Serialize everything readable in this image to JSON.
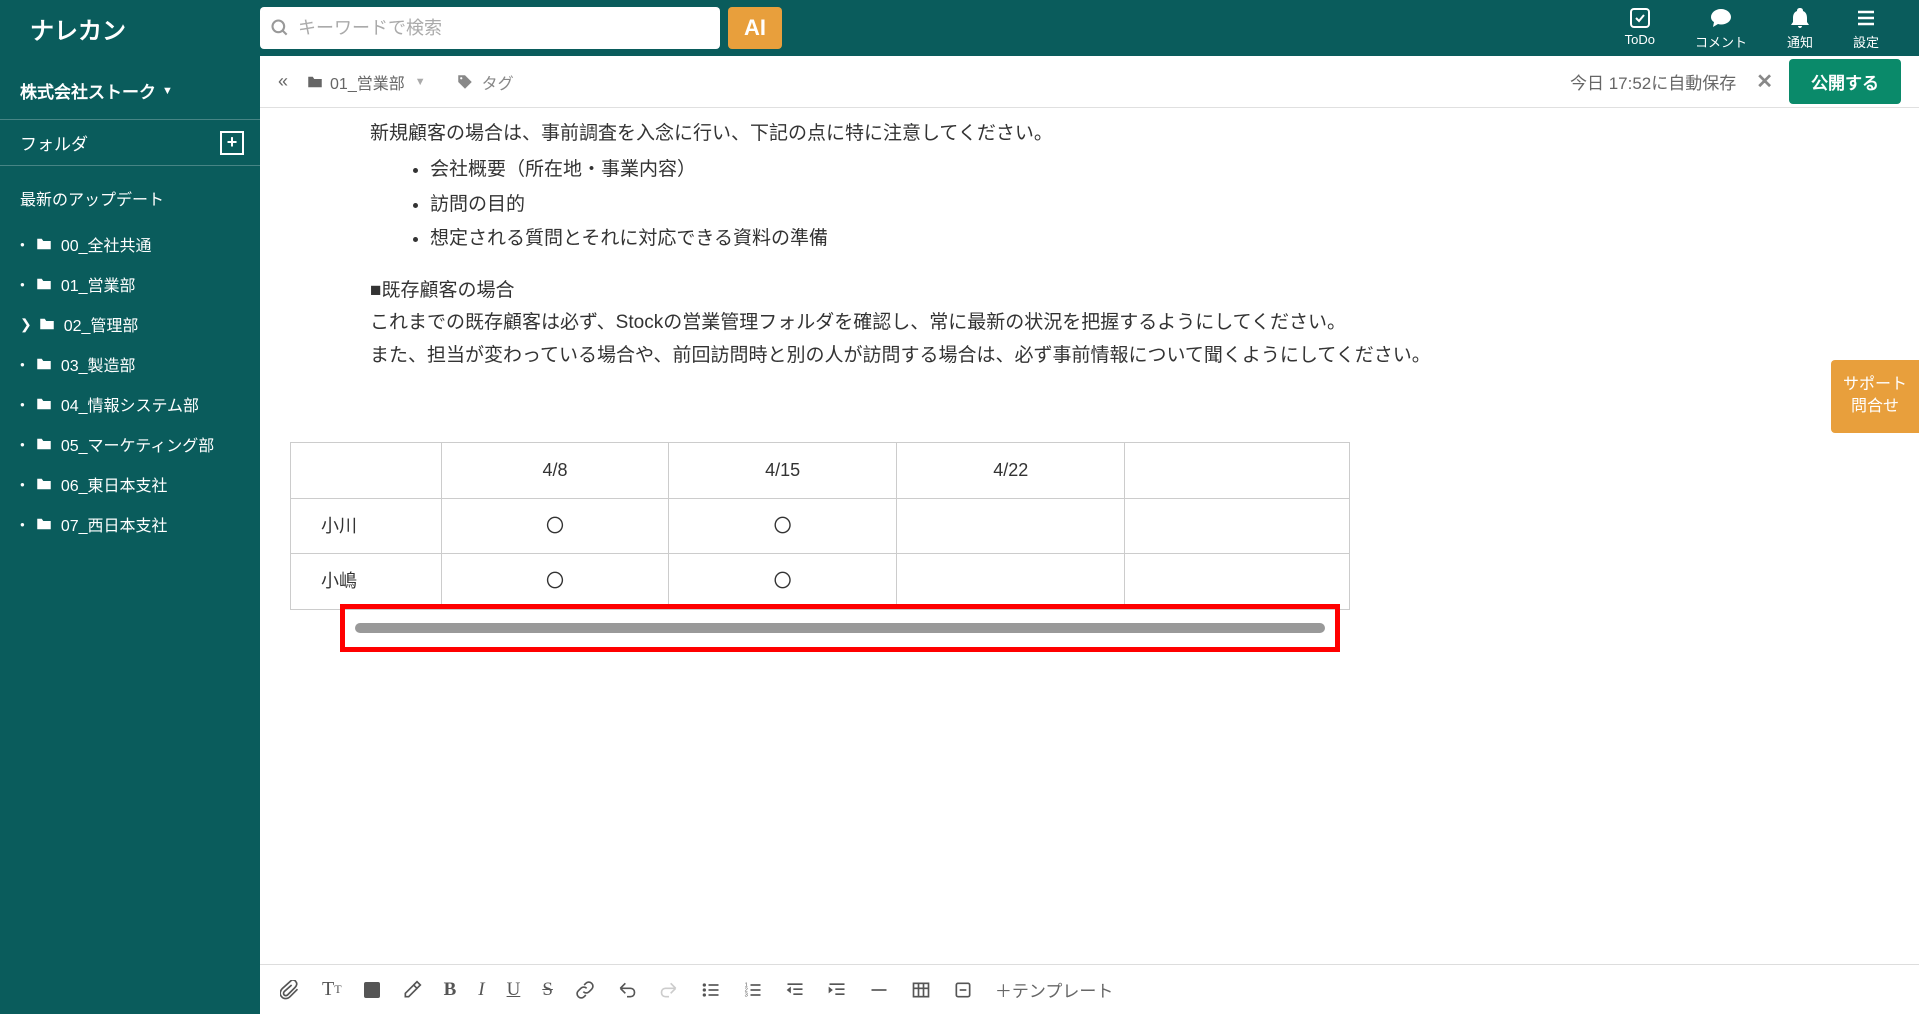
{
  "header": {
    "logo": "ナレカン",
    "search_placeholder": "キーワードで検索",
    "ai_label": "AI",
    "actions": [
      {
        "icon": "check-square",
        "label": "ToDo"
      },
      {
        "icon": "comment",
        "label": "コメント"
      },
      {
        "icon": "bell",
        "label": "通知"
      },
      {
        "icon": "menu",
        "label": "設定"
      }
    ]
  },
  "sidebar": {
    "org_name": "株式会社ストーク",
    "folder_label": "フォルダ",
    "updates_label": "最新のアップデート",
    "folders": [
      {
        "name": "00_全社共通",
        "expandable": false
      },
      {
        "name": "01_営業部",
        "expandable": false
      },
      {
        "name": "02_管理部",
        "expandable": true
      },
      {
        "name": "03_製造部",
        "expandable": false
      },
      {
        "name": "04_情報システム部",
        "expandable": false
      },
      {
        "name": "05_マーケティング部",
        "expandable": false
      },
      {
        "name": "06_東日本支社",
        "expandable": false
      },
      {
        "name": "07_西日本支社",
        "expandable": false
      }
    ]
  },
  "breadcrumb": {
    "folder": "01_営業部",
    "tag_label": "タグ",
    "autosave": "今日 17:52に自動保存",
    "publish": "公開する"
  },
  "document": {
    "intro_partial": "新規顧客の場合は、事前調査を入念に行い、下記の点に特に注意してください。",
    "bullets": [
      "会社概要（所在地・事業内容）",
      "訪問の目的",
      "想定される質問とそれに対応できる資料の準備"
    ],
    "section2_heading": "■既存顧客の場合",
    "section2_p1": "これまでの既存顧客は必ず、Stockの営業管理フォルダを確認し、常に最新の状況を把握するようにしてください。",
    "section2_p2": "また、担当が変わっている場合や、前回訪問時と別の人が訪問する場合は、必ず事前情報について聞くようにしてください。",
    "table": {
      "headers": [
        "",
        "4/8",
        "4/15",
        "4/22",
        ""
      ],
      "rows": [
        {
          "name": "小川",
          "cells": [
            "〇",
            "〇",
            "",
            ""
          ]
        },
        {
          "name": "小嶋",
          "cells": [
            "〇",
            "〇",
            "",
            ""
          ]
        }
      ]
    }
  },
  "support": {
    "line1": "サポート",
    "line2": "問合せ"
  },
  "toolbar": {
    "template_label": "テンプレート"
  }
}
